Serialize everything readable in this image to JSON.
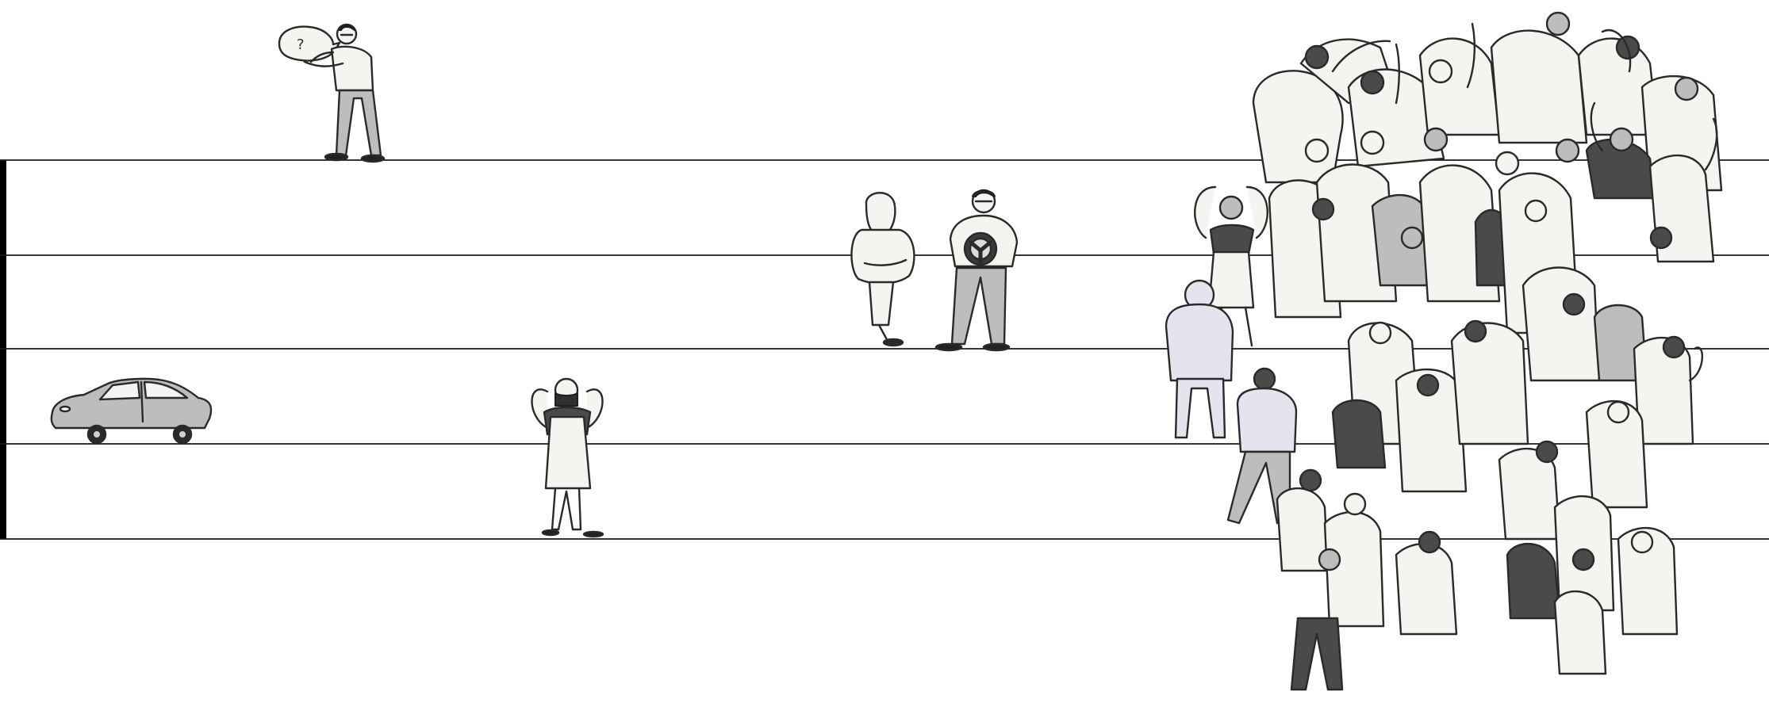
{
  "scene": {
    "background_color": "#ffffff",
    "line_color": "#1a1a1a",
    "bar_color": "#000000",
    "pencil_color": "#2a2a2a",
    "light_fill": "#f3f5f1",
    "mid_fill": "#bdbdbd",
    "dark_fill": "#4a4a4a",
    "lavender_fill": "#e4e4ef"
  },
  "speech_bubble": {
    "text": "?"
  },
  "icons": {
    "car": "car-icon",
    "steering_wheel": "steering-wheel-icon",
    "speech_bubble": "speech-bubble-icon"
  }
}
